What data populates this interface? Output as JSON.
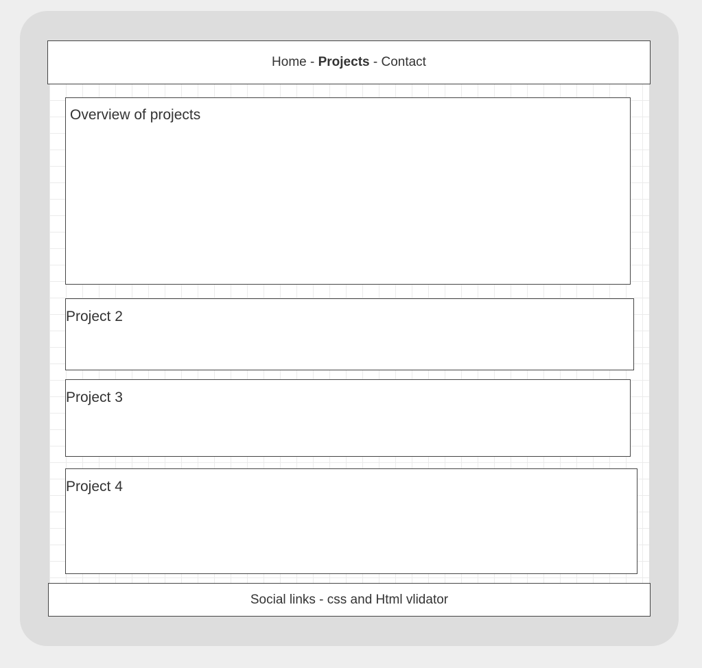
{
  "nav": {
    "home": "Home",
    "sep1": " - ",
    "projects": "Projects",
    "sep2": " - ",
    "contact": "Contact"
  },
  "overview": {
    "title": "Overview of projects"
  },
  "projects": [
    {
      "title": "Project 2"
    },
    {
      "title": "Project 3"
    },
    {
      "title": "Project 4"
    }
  ],
  "footer": {
    "text": "Social links - css and Html vlidator"
  }
}
